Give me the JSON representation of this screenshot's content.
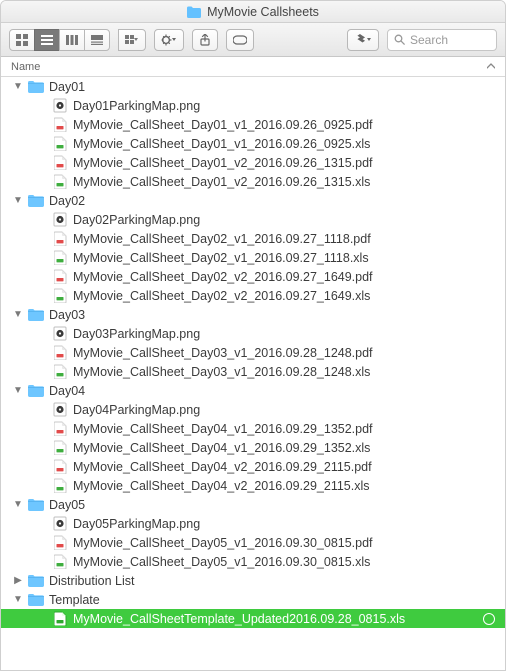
{
  "title": "MyMovie Callsheets",
  "search_placeholder": "Search",
  "column_header": "Name",
  "icons": {
    "folder": "folder-icon",
    "png": "png-icon",
    "pdf": "pdf-icon",
    "xls": "xls-icon"
  },
  "tree": [
    {
      "name": "Day01",
      "type": "folder",
      "expanded": true,
      "children": [
        {
          "name": "Day01ParkingMap.png",
          "type": "png"
        },
        {
          "name": "MyMovie_CallSheet_Day01_v1_2016.09.26_0925.pdf",
          "type": "pdf"
        },
        {
          "name": "MyMovie_CallSheet_Day01_v1_2016.09.26_0925.xls",
          "type": "xls"
        },
        {
          "name": "MyMovie_CallSheet_Day01_v2_2016.09.26_1315.pdf",
          "type": "pdf"
        },
        {
          "name": "MyMovie_CallSheet_Day01_v2_2016.09.26_1315.xls",
          "type": "xls"
        }
      ]
    },
    {
      "name": "Day02",
      "type": "folder",
      "expanded": true,
      "children": [
        {
          "name": "Day02ParkingMap.png",
          "type": "png"
        },
        {
          "name": "MyMovie_CallSheet_Day02_v1_2016.09.27_1118.pdf",
          "type": "pdf"
        },
        {
          "name": "MyMovie_CallSheet_Day02_v1_2016.09.27_1118.xls",
          "type": "xls"
        },
        {
          "name": "MyMovie_CallSheet_Day02_v2_2016.09.27_1649.pdf",
          "type": "pdf"
        },
        {
          "name": "MyMovie_CallSheet_Day02_v2_2016.09.27_1649.xls",
          "type": "xls"
        }
      ]
    },
    {
      "name": "Day03",
      "type": "folder",
      "expanded": true,
      "children": [
        {
          "name": "Day03ParkingMap.png",
          "type": "png"
        },
        {
          "name": "MyMovie_CallSheet_Day03_v1_2016.09.28_1248.pdf",
          "type": "pdf"
        },
        {
          "name": "MyMovie_CallSheet_Day03_v1_2016.09.28_1248.xls",
          "type": "xls"
        }
      ]
    },
    {
      "name": "Day04",
      "type": "folder",
      "expanded": true,
      "children": [
        {
          "name": "Day04ParkingMap.png",
          "type": "png"
        },
        {
          "name": "MyMovie_CallSheet_Day04_v1_2016.09.29_1352.pdf",
          "type": "pdf"
        },
        {
          "name": "MyMovie_CallSheet_Day04_v1_2016.09.29_1352.xls",
          "type": "xls"
        },
        {
          "name": "MyMovie_CallSheet_Day04_v2_2016.09.29_2115.pdf",
          "type": "pdf"
        },
        {
          "name": "MyMovie_CallSheet_Day04_v2_2016.09.29_2115.xls",
          "type": "xls"
        }
      ]
    },
    {
      "name": "Day05",
      "type": "folder",
      "expanded": true,
      "children": [
        {
          "name": "Day05ParkingMap.png",
          "type": "png"
        },
        {
          "name": "MyMovie_CallSheet_Day05_v1_2016.09.30_0815.pdf",
          "type": "pdf"
        },
        {
          "name": "MyMovie_CallSheet_Day05_v1_2016.09.30_0815.xls",
          "type": "xls"
        }
      ]
    },
    {
      "name": "Distribution List",
      "type": "folder",
      "expanded": false,
      "children": []
    },
    {
      "name": "Template",
      "type": "folder",
      "expanded": true,
      "children": [
        {
          "name": "MyMovie_CallSheetTemplate_Updated2016.09.28_0815.xls",
          "type": "xls",
          "selected": true
        }
      ]
    }
  ]
}
